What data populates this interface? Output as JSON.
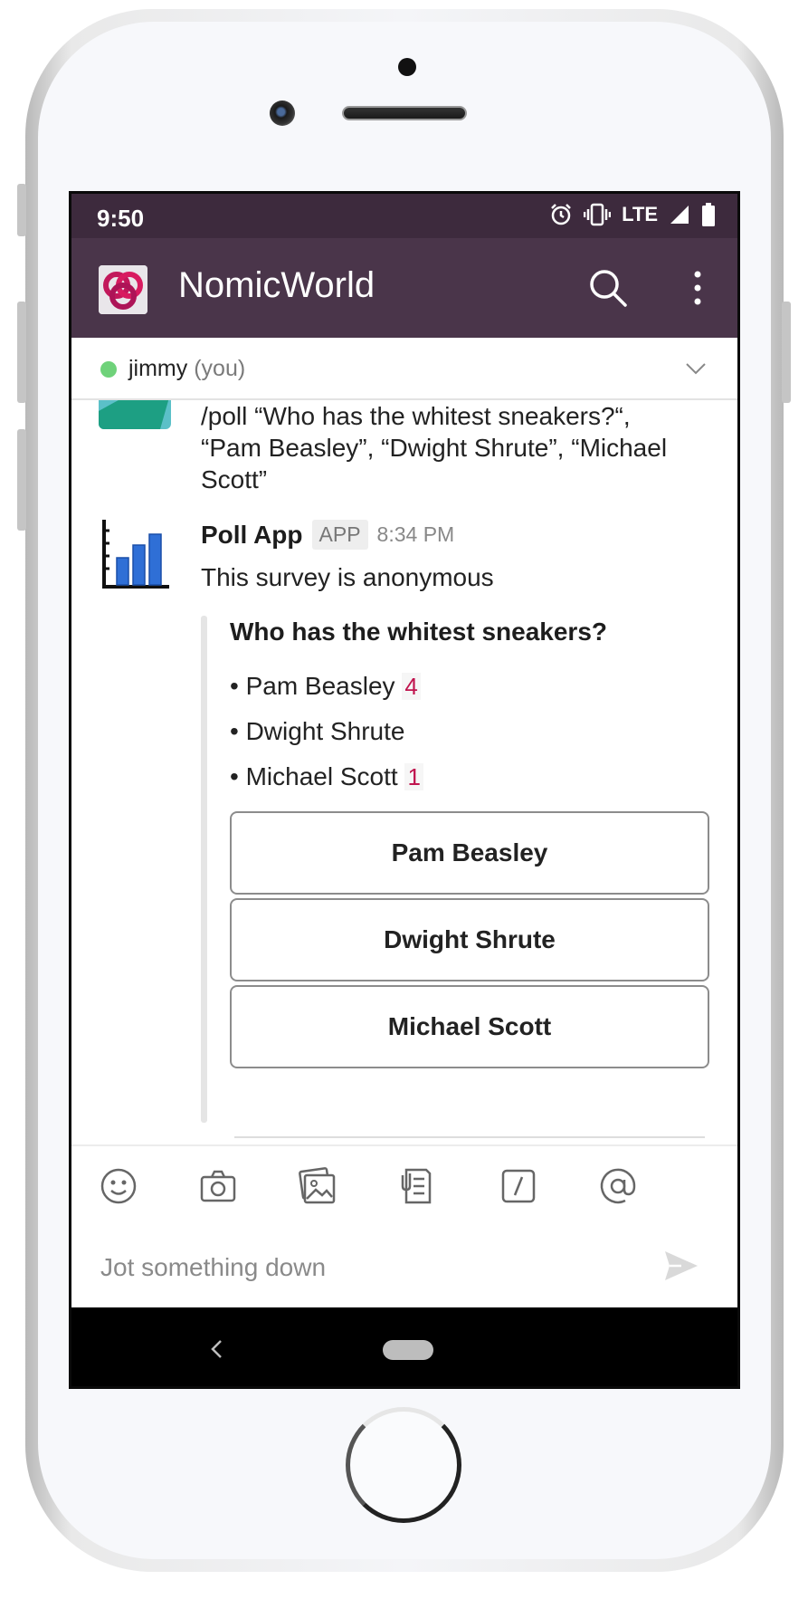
{
  "status_bar": {
    "time": "9:50",
    "network": "LTE"
  },
  "app_bar": {
    "title": "NomicWorld"
  },
  "presence": {
    "name": "jimmy",
    "suffix": "(you)"
  },
  "previous_message": {
    "lines": [
      "/poll “Who has the whitest sneakers?“,",
      "“Pam Beasley”, “Dwight Shrute”, “Michael",
      "Scott”"
    ]
  },
  "poll_message": {
    "sender": "Poll App",
    "badge": "APP",
    "time": "8:34 PM",
    "subtitle": "This survey is anonymous",
    "question": "Who has the whitest sneakers?",
    "options": [
      {
        "label": "• Pam Beasley",
        "votes": "4"
      },
      {
        "label": "• Dwight Shrute",
        "votes": ""
      },
      {
        "label": "• Michael Scott",
        "votes": "1"
      }
    ],
    "buttons": [
      "Pam Beasley",
      "Dwight Shrute",
      "Michael Scott"
    ]
  },
  "composer": {
    "placeholder": "Jot something down"
  },
  "colors": {
    "status_bar": "#3d2a3d",
    "app_bar": "#4a354a",
    "vote_count": "#c0144e",
    "presence": "#6fd27a",
    "chart_blue": "#2f6fd6"
  }
}
